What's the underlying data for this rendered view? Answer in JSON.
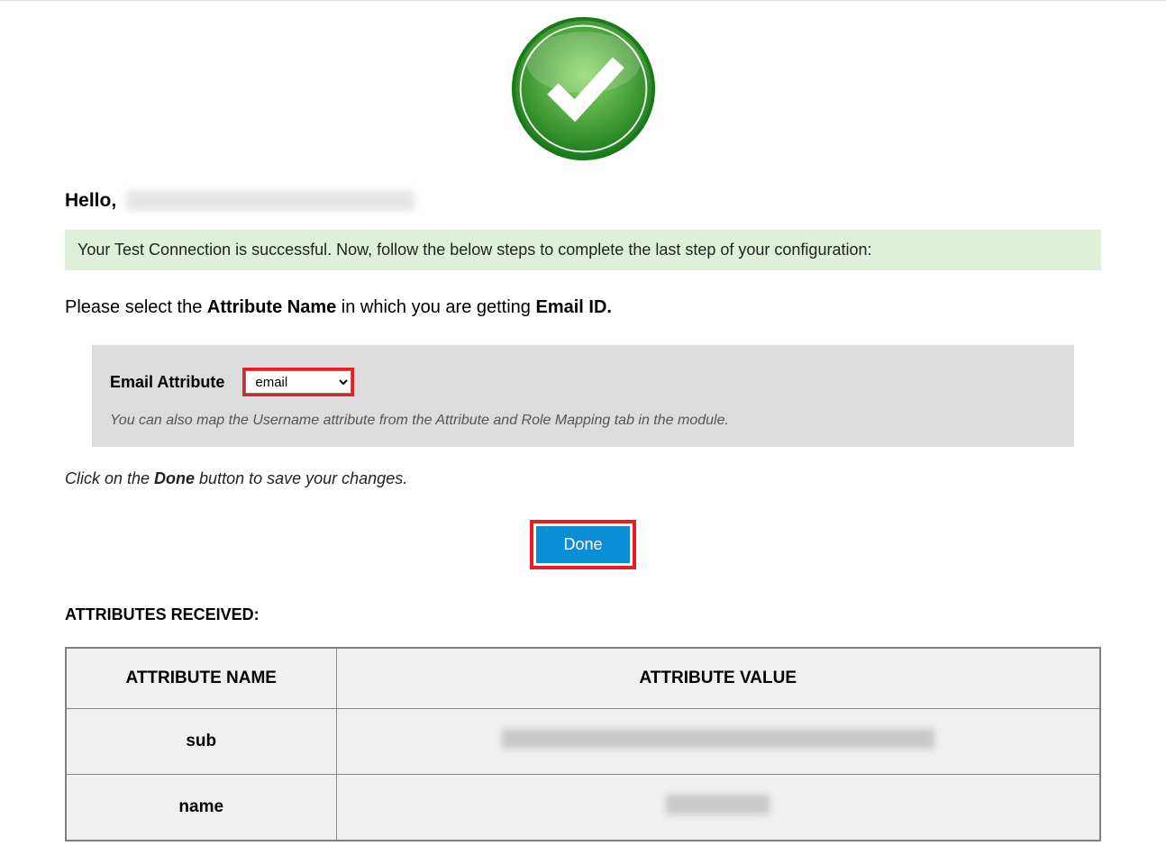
{
  "greeting": {
    "hello": "Hello,"
  },
  "banner": {
    "message": "Your Test Connection is successful. Now, follow the below steps to complete the last step of your configuration:"
  },
  "instruction": {
    "prefix": "Please select the ",
    "bold1": "Attribute Name",
    "middle": " in which you are getting ",
    "bold2": "Email ID."
  },
  "panel": {
    "label": "Email Attribute",
    "selected": "email",
    "hint": "You can also map the Username attribute from the Attribute and Role Mapping tab in the module."
  },
  "save_instruction": {
    "prefix": "Click on the ",
    "bold": "Done",
    "suffix": " button to save your changes."
  },
  "button": {
    "done": "Done"
  },
  "table": {
    "heading": "ATTRIBUTES RECEIVED:",
    "header_name": "ATTRIBUTE NAME",
    "header_value": "ATTRIBUTE VALUE",
    "rows": [
      {
        "name": "sub"
      },
      {
        "name": "name"
      }
    ]
  }
}
